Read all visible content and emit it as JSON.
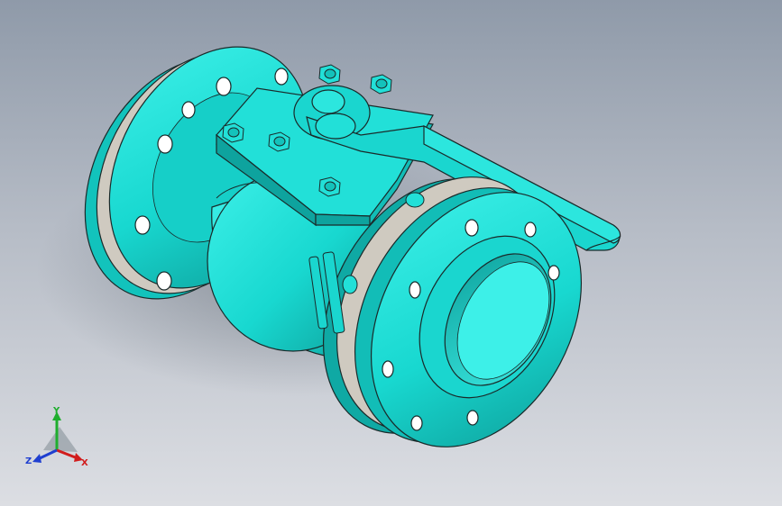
{
  "window": {
    "background_top": "#8f9aa9",
    "background_bottom": "#dcdee3"
  },
  "model": {
    "name": "",
    "body_color": "#18d8d0",
    "body_shade_color": "#0fa9a4",
    "gasket_color": "#cfcac0",
    "outline_color": "#1a2a2a",
    "bolt_hole_count_per_flange": 8
  },
  "triad": {
    "y_label": "Y",
    "x_label": "X",
    "z_label": "Z",
    "y_color": "#1fae2e",
    "x_color": "#d11c1c",
    "z_color": "#1f3fd0"
  }
}
